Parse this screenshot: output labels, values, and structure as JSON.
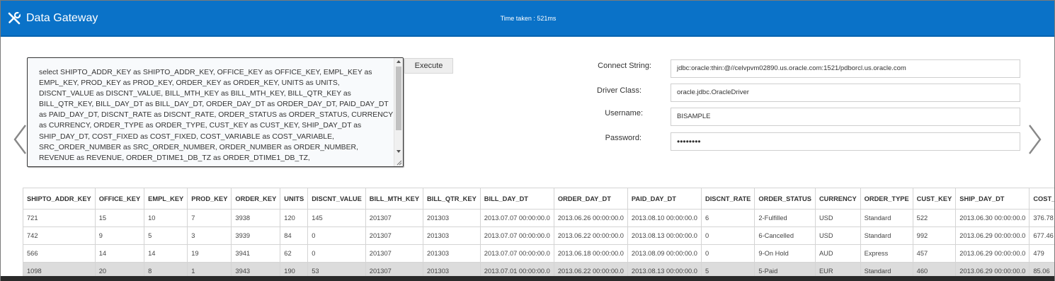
{
  "header": {
    "app_title": "Data Gateway",
    "time_taken": "Time taken : 521ms",
    "icon": "tools-icon"
  },
  "query": {
    "text": "select SHIPTO_ADDR_KEY as SHIPTO_ADDR_KEY, OFFICE_KEY as OFFICE_KEY, EMPL_KEY as EMPL_KEY, PROD_KEY as PROD_KEY, ORDER_KEY as ORDER_KEY, UNITS as UNITS, DISCNT_VALUE as DISCNT_VALUE, BILL_MTH_KEY as BILL_MTH_KEY, BILL_QTR_KEY as BILL_QTR_KEY, BILL_DAY_DT as BILL_DAY_DT, ORDER_DAY_DT as ORDER_DAY_DT, PAID_DAY_DT as PAID_DAY_DT, DISCNT_RATE as DISCNT_RATE, ORDER_STATUS as ORDER_STATUS, CURRENCY as CURRENCY, ORDER_TYPE as ORDER_TYPE, CUST_KEY as CUST_KEY, SHIP_DAY_DT as SHIP_DAY_DT, COST_FIXED as COST_FIXED, COST_VARIABLE as COST_VARIABLE, SRC_ORDER_NUMBER as SRC_ORDER_NUMBER, ORDER_NUMBER as ORDER_NUMBER, REVENUE as REVENUE, ORDER_DTIME1_DB_TZ as ORDER_DTIME1_DB_TZ,",
    "execute_label": "Execute"
  },
  "connection": {
    "connect_string_label": "Connect String:",
    "connect_string_value": "jdbc:oracle:thin:@//celvpvm02890.us.oracle.com:1521/pdborcl.us.oracle.com",
    "driver_class_label": "Driver Class:",
    "driver_class_value": "oracle.jdbc.OracleDriver",
    "username_label": "Username:",
    "username_value": "BISAMPLE",
    "password_label": "Password:",
    "password_value": "••••••••"
  },
  "nav": {
    "prev_icon": "chevron-left-icon",
    "next_icon": "chevron-right-icon"
  },
  "table": {
    "columns": [
      "SHIPTO_ADDR_KEY",
      "OFFICE_KEY",
      "EMPL_KEY",
      "PROD_KEY",
      "ORDER_KEY",
      "UNITS",
      "DISCNT_VALUE",
      "BILL_MTH_KEY",
      "BILL_QTR_KEY",
      "BILL_DAY_DT",
      "ORDER_DAY_DT",
      "PAID_DAY_DT",
      "DISCNT_RATE",
      "ORDER_STATUS",
      "CURRENCY",
      "ORDER_TYPE",
      "CUST_KEY",
      "SHIP_DAY_DT",
      "COST_"
    ],
    "rows": [
      [
        "721",
        "15",
        "10",
        "7",
        "3938",
        "120",
        "145",
        "201307",
        "201303",
        "2013.07.07 00:00:00.0",
        "2013.06.26 00:00:00.0",
        "2013.08.10 00:00:00.0",
        "6",
        "2-Fulfilled",
        "USD",
        "Standard",
        "522",
        "2013.06.30 00:00:00.0",
        "376.78"
      ],
      [
        "742",
        "9",
        "5",
        "3",
        "3939",
        "84",
        "0",
        "201307",
        "201303",
        "2013.07.07 00:00:00.0",
        "2013.06.22 00:00:00.0",
        "2013.08.13 00:00:00.0",
        "0",
        "6-Cancelled",
        "USD",
        "Standard",
        "992",
        "2013.06.29 00:00:00.0",
        "677.46"
      ],
      [
        "566",
        "14",
        "14",
        "19",
        "3941",
        "62",
        "0",
        "201307",
        "201303",
        "2013.07.07 00:00:00.0",
        "2013.06.18 00:00:00.0",
        "2013.08.09 00:00:00.0",
        "0",
        "9-On Hold",
        "AUD",
        "Express",
        "457",
        "2013.06.29 00:00:00.0",
        "479"
      ],
      [
        "1098",
        "20",
        "8",
        "1",
        "3943",
        "190",
        "53",
        "201307",
        "201303",
        "2013.07.01 00:00:00.0",
        "2013.06.22 00:00:00.0",
        "2013.08.13 00:00:00.0",
        "5",
        "5-Paid",
        "EUR",
        "Standard",
        "460",
        "2013.06.29 00:00:00.0",
        "85.06"
      ]
    ],
    "highlighted_row": 3
  },
  "colors": {
    "header_bg": "#0a72c8",
    "row_highlight": "#dcdcdc"
  }
}
